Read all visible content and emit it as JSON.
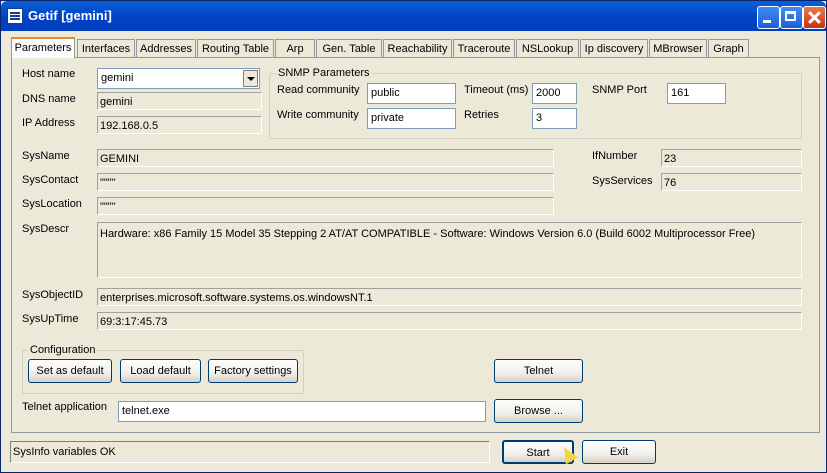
{
  "window": {
    "title": "Getif [gemini]"
  },
  "tabs": [
    "Parameters",
    "Interfaces",
    "Addresses",
    "Routing Table",
    "Arp",
    "Gen. Table",
    "Reachability",
    "Traceroute",
    "NSLookup",
    "Ip discovery",
    "MBrowser",
    "Graph"
  ],
  "host": {
    "host_name_label": "Host name",
    "host_name_value": "gemini",
    "dns_label": "DNS name",
    "dns_value": "gemini",
    "ip_label": "IP Address",
    "ip_value": "192.168.0.5"
  },
  "snmp": {
    "group_label": "SNMP Parameters",
    "read_label": "Read community",
    "read_value": "public",
    "write_label": "Write community",
    "write_value": "private",
    "timeout_label": "Timeout (ms)",
    "timeout_value": "2000",
    "retries_label": "Retries",
    "retries_value": "3",
    "port_label": "SNMP Port",
    "port_value": "161"
  },
  "sys": {
    "name_label": "SysName",
    "name_value": "GEMINI",
    "contact_label": "SysContact",
    "contact_value": "\"\"\"\"",
    "location_label": "SysLocation",
    "location_value": "\"\"\"\"",
    "descr_label": "SysDescr",
    "descr_value": "Hardware: x86 Family 15 Model 35 Stepping 2 AT/AT COMPATIBLE - Software: Windows Version 6.0 (Build 6002 Multiprocessor Free)",
    "objectid_label": "SysObjectID",
    "objectid_value": "enterprises.microsoft.software.systems.os.windowsNT.1",
    "uptime_label": "SysUpTime",
    "uptime_value": "69:3:17:45.73",
    "ifnumber_label": "IfNumber",
    "ifnumber_value": "23",
    "services_label": "SysServices",
    "services_value": "76"
  },
  "config": {
    "group_label": "Configuration",
    "set_default": "Set as default",
    "load_default": "Load default",
    "factory": "Factory settings"
  },
  "telnet": {
    "button": "Telnet",
    "app_label": "Telnet application",
    "app_value": "telnet.exe",
    "browse": "Browse ..."
  },
  "footer": {
    "status": "SysInfo variables OK",
    "start": "Start",
    "exit": "Exit"
  }
}
